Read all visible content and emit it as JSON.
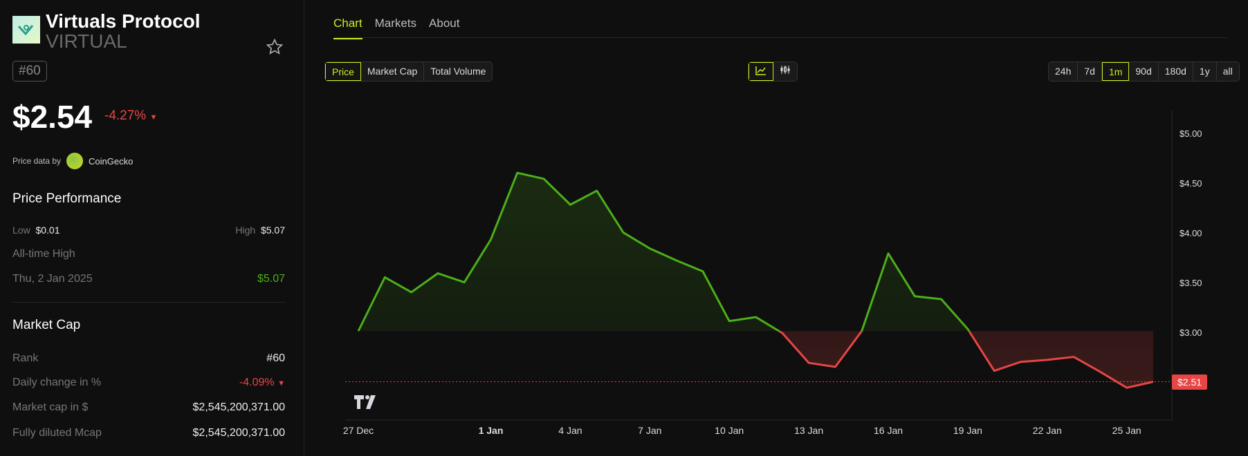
{
  "coin": {
    "name": "Virtuals Protocol",
    "symbol": "VIRTUAL",
    "rank_badge": "#60",
    "price": "$2.54",
    "change_24h": "-4.27%",
    "price_source_label": "Price data by",
    "price_source": "CoinGecko"
  },
  "performance": {
    "heading": "Price Performance",
    "low_label": "Low",
    "low": "$0.01",
    "high_label": "High",
    "high": "$5.07",
    "ath_label": "All-time High",
    "ath_date": "Thu, 2 Jan 2025",
    "ath_value": "$5.07"
  },
  "market_cap": {
    "heading": "Market Cap",
    "rows": [
      {
        "label": "Rank",
        "value": "#60"
      },
      {
        "label": "Daily change in %",
        "value": "-4.09%"
      },
      {
        "label": "Market cap in $",
        "value": "$2,545,200,371.00"
      },
      {
        "label": "Fully diluted Mcap",
        "value": "$2,545,200,371.00"
      }
    ]
  },
  "tabs": [
    "Chart",
    "Markets",
    "About"
  ],
  "metric_buttons": [
    "Price",
    "Market Cap",
    "Total Volume"
  ],
  "range_buttons": [
    "24h",
    "7d",
    "1m",
    "90d",
    "180d",
    "1y",
    "all"
  ],
  "selected_range": "1m",
  "colors": {
    "accent": "#c8f01e",
    "up": "#4caf1a",
    "down": "#e84545"
  },
  "chart_data": {
    "type": "line",
    "x": [
      "27 Dec",
      "28 Dec",
      "29 Dec",
      "30 Dec",
      "31 Dec",
      "1 Jan",
      "2 Jan",
      "3 Jan",
      "4 Jan",
      "5 Jan",
      "6 Jan",
      "7 Jan",
      "8 Jan",
      "9 Jan",
      "10 Jan",
      "11 Jan",
      "12 Jan",
      "13 Jan",
      "14 Jan",
      "15 Jan",
      "16 Jan",
      "17 Jan",
      "18 Jan",
      "19 Jan",
      "20 Jan",
      "21 Jan",
      "22 Jan",
      "23 Jan",
      "24 Jan",
      "25 Jan",
      "26 Jan"
    ],
    "values": [
      3.02,
      3.56,
      3.41,
      3.6,
      3.51,
      3.94,
      4.61,
      4.55,
      4.29,
      4.43,
      4.01,
      3.85,
      3.73,
      3.62,
      3.12,
      3.16,
      3.0,
      2.7,
      2.66,
      3.02,
      3.8,
      3.37,
      3.34,
      3.04,
      2.62,
      2.71,
      2.73,
      2.76,
      2.61,
      2.45,
      2.51
    ],
    "baseline": 3.02,
    "ylim": [
      2.14,
      5.23
    ],
    "yticks": [
      "$5.00",
      "$4.50",
      "$4.00",
      "$3.50",
      "$3.00"
    ],
    "ytick_values": [
      5,
      4.5,
      4,
      3.5,
      3
    ],
    "xticks": [
      "27 Dec",
      "1 Jan",
      "4 Jan",
      "7 Jan",
      "10 Jan",
      "13 Jan",
      "16 Jan",
      "19 Jan",
      "22 Jan",
      "25 Jan"
    ],
    "xtick_index": [
      0,
      5,
      8,
      11,
      14,
      17,
      20,
      23,
      26,
      29
    ],
    "current_price_label": "$2.51",
    "current_price": 2.51
  }
}
